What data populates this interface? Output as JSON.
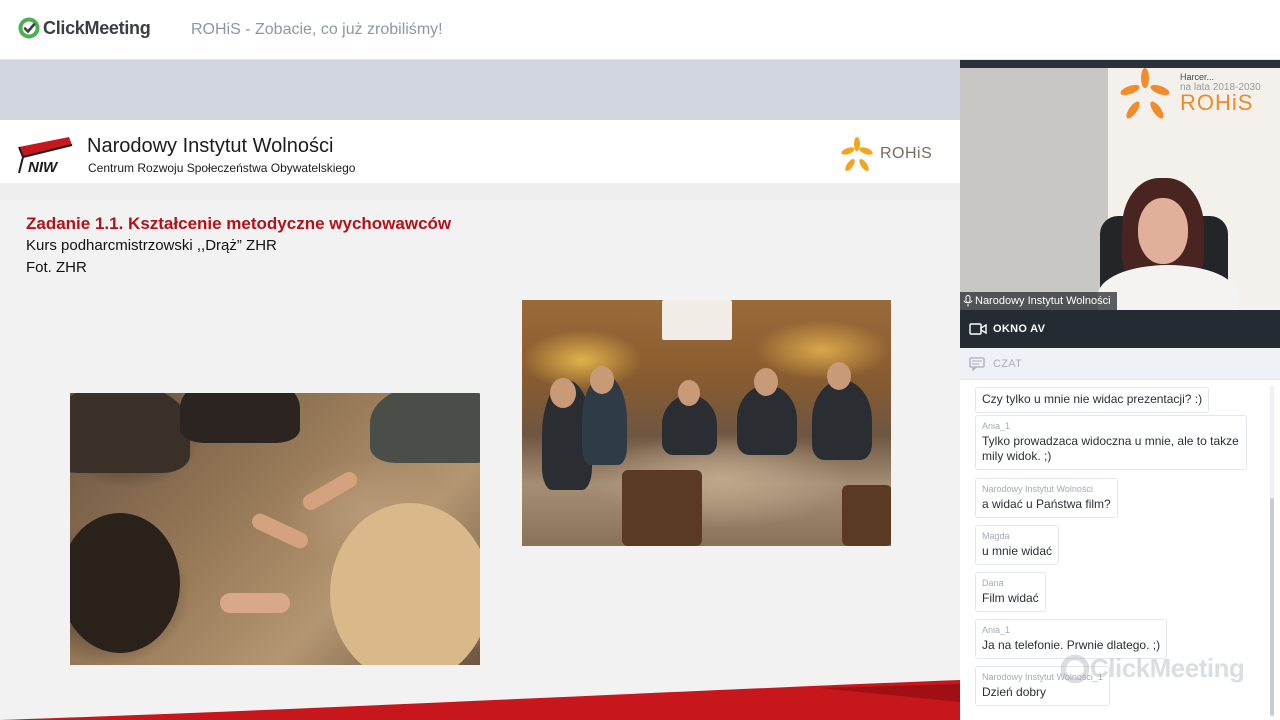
{
  "brand": {
    "name": "ClickMeeting",
    "accent": "#4caf50"
  },
  "meeting": {
    "title": "ROHiS - Zobacie, co już zrobiliśmy!"
  },
  "slide": {
    "header_title": "Narodowy Instytut Wolności",
    "header_subtitle": "Centrum Rozwoju Społeczeństwa Obywatelskiego",
    "niw_logo_text": "NIW",
    "rohis_logo_text": "ROHiS",
    "task_title": "Zadanie 1.1. Kształcenie metodyczne wychowawców",
    "lines": [
      "Kurs podharcmistrzowski ,,Drąż” ZHR",
      "Fot. ZHR"
    ],
    "accent_color": "#c8161d"
  },
  "video": {
    "participant_label": "Narodowy Instytut Wolności",
    "banner_line1": "Harcer...",
    "banner_line2": "na lata 2018-2030",
    "banner_logo": "ROHiS"
  },
  "av_window": {
    "label": "OKNO AV"
  },
  "chat": {
    "label": "CZAT",
    "watermark": "ClickMeeting",
    "messages": [
      {
        "author": "",
        "text": "Czy tylko u mnie nie widac prezentacji? :)"
      },
      {
        "author": "Ania_1",
        "text": "Tylko prowadzaca widoczna u mnie, ale to takze mily widok. ;)"
      },
      {
        "author": "Narodowy Instytut Wolności",
        "text": "a widać u Państwa film?"
      },
      {
        "author": "Magda",
        "text": "u mnie widać"
      },
      {
        "author": "Dana",
        "text": "Film widać"
      },
      {
        "author": "Ania_1",
        "text": "Ja na telefonie. Prwnie dlatego. ;)"
      },
      {
        "author": "Narodowy Instytut Wolności_1",
        "text": "Dzień dobry"
      }
    ]
  }
}
